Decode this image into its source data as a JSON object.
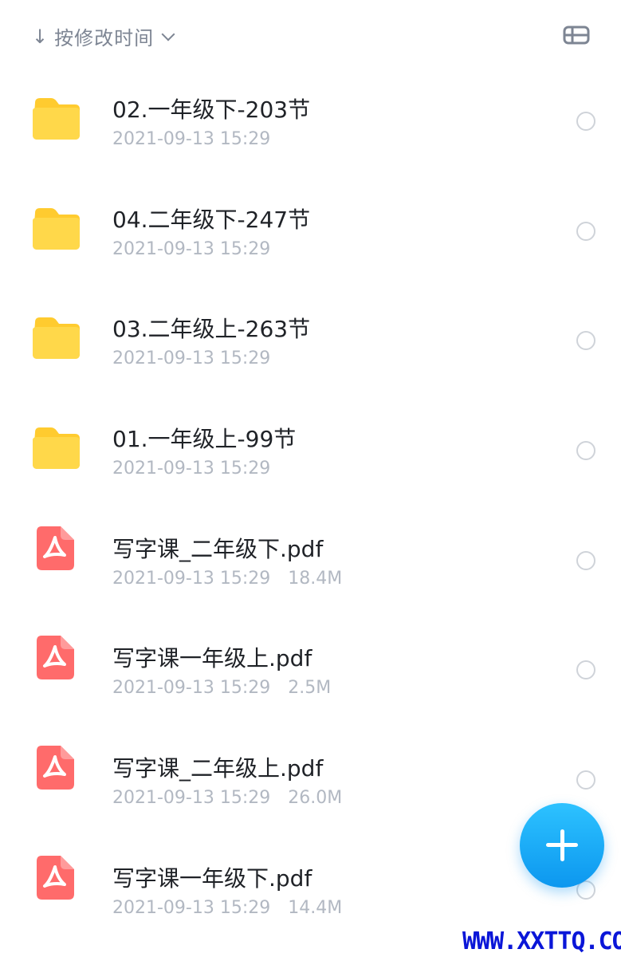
{
  "header": {
    "sort_arrow": "↓",
    "sort_label": "按修改时间"
  },
  "files": [
    {
      "type": "folder",
      "name": "02.一年级下-203节",
      "date": "2021-09-13 15:29",
      "size": ""
    },
    {
      "type": "folder",
      "name": "04.二年级下-247节",
      "date": "2021-09-13 15:29",
      "size": ""
    },
    {
      "type": "folder",
      "name": "03.二年级上-263节",
      "date": "2021-09-13 15:29",
      "size": ""
    },
    {
      "type": "folder",
      "name": "01.一年级上-99节",
      "date": "2021-09-13 15:29",
      "size": ""
    },
    {
      "type": "pdf",
      "name": "写字课_二年级下.pdf",
      "date": "2021-09-13 15:29",
      "size": "18.4M"
    },
    {
      "type": "pdf",
      "name": "写字课一年级上.pdf",
      "date": "2021-09-13 15:29",
      "size": "2.5M"
    },
    {
      "type": "pdf",
      "name": "写字课_二年级上.pdf",
      "date": "2021-09-13 15:29",
      "size": "26.0M"
    },
    {
      "type": "pdf",
      "name": "写字课一年级下.pdf",
      "date": "2021-09-13 15:29",
      "size": "14.4M"
    }
  ],
  "icons": {
    "folder": "folder-icon",
    "pdf": "pdf-icon",
    "view": "list-view-icon",
    "add": "plus-icon"
  },
  "colors": {
    "folder": "#ffd84a",
    "pdf": "#ff6b6b",
    "accent": "#1fa9f8",
    "watermark": "#0a16d8"
  },
  "watermark": "WWW.XXTTQ.COM"
}
